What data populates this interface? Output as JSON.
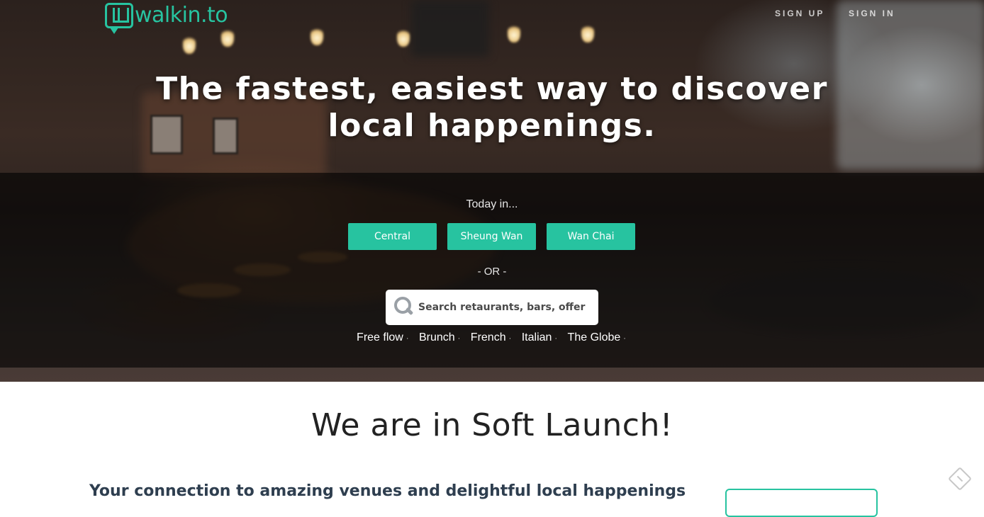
{
  "brand": {
    "name": "walkin.to",
    "accent_color": "#27c3a0"
  },
  "nav": {
    "sign_up": "SIGN UP",
    "sign_in": "SIGN IN"
  },
  "hero": {
    "title": "The fastest, easiest way to discover local happenings.",
    "today_label": "Today in...",
    "areas": [
      "Central",
      "Sheung Wan",
      "Wan Chai"
    ],
    "or_label": "- OR -",
    "search": {
      "placeholder": "Search retaurants, bars, offers...",
      "icon": "search-icon"
    },
    "tags": [
      "Free flow",
      "Brunch",
      "French",
      "Italian",
      "The Globe"
    ],
    "tag_separator": "·"
  },
  "content": {
    "soft_launch_heading": "We are in Soft Launch!",
    "connection_heading": "Your connection to amazing venues and delightful local happenings"
  }
}
